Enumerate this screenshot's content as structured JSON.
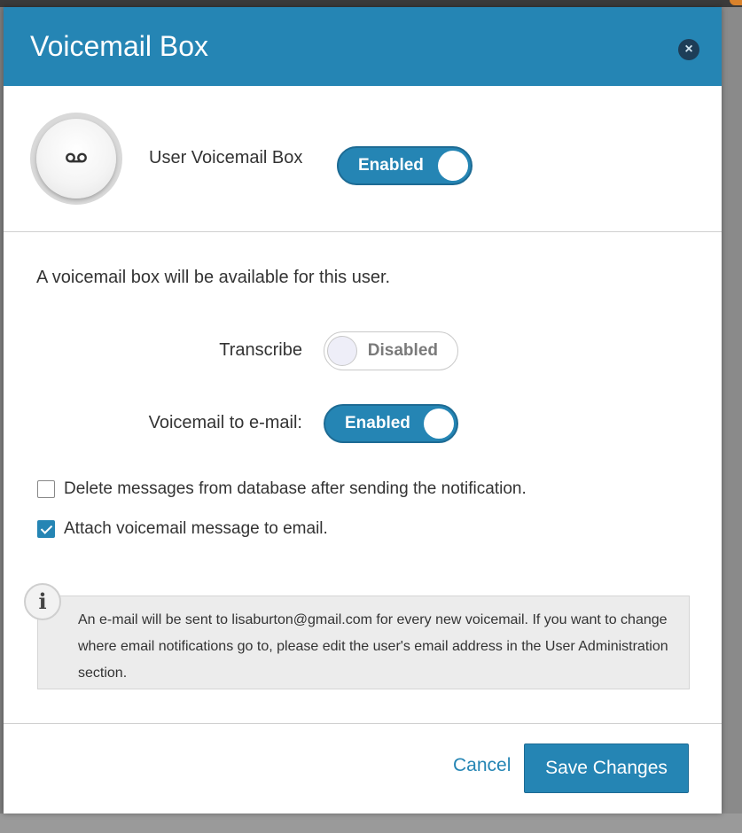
{
  "modal": {
    "title": "Voicemail Box",
    "close_icon": "close-icon"
  },
  "user_voicemail": {
    "label": "User Voicemail Box",
    "toggle_value": "Enabled",
    "avatar_icon": "voicemail-icon"
  },
  "description": "A voicemail box will be available for this user.",
  "transcribe": {
    "label": "Transcribe",
    "toggle_value": "Disabled"
  },
  "voicemail_to_email": {
    "label": "Voicemail to e-mail:",
    "toggle_value": "Enabled"
  },
  "options": [
    {
      "label": "Delete messages from database after sending the notification.",
      "checked": false
    },
    {
      "label": "Attach voicemail message to email.",
      "checked": true
    }
  ],
  "info": {
    "icon": "info-icon",
    "glyph": "i",
    "text": "An e-mail will be sent to lisaburton@gmail.com for every new voicemail. If you want to change where email notifications go to, please edit the user's email address in the User Administration section."
  },
  "footer": {
    "cancel_label": "Cancel",
    "save_label": "Save Changes"
  },
  "colors": {
    "accent": "#2585b4",
    "close_button": "#1d3d57"
  }
}
